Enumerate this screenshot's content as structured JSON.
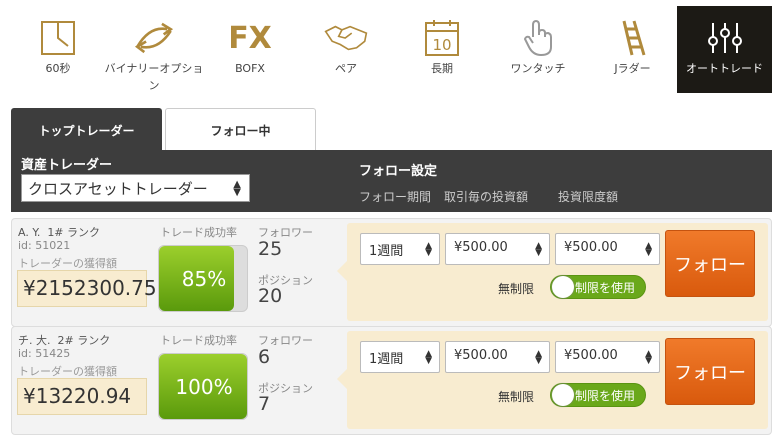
{
  "nav": [
    {
      "icon": "timer-60-icon",
      "label": "60秒"
    },
    {
      "icon": "binary-arrows-icon",
      "label": "バイナリーオプション"
    },
    {
      "icon": "fx-icon",
      "label": "BOFX"
    },
    {
      "icon": "handshake-icon",
      "label": "ペア"
    },
    {
      "icon": "calendar-10-icon",
      "label": "長期"
    },
    {
      "icon": "touch-hand-icon",
      "label": "ワンタッチ"
    },
    {
      "icon": "ladder-icon",
      "label": "Jラダー"
    },
    {
      "icon": "sliders-icon",
      "label": "オートトレード"
    }
  ],
  "tabs": {
    "top": "トップトレーダー",
    "following": "フォロー中"
  },
  "header": {
    "asset_label": "資産トレーダー",
    "asset_select": "クロスアセットトレーダー",
    "follow_settings": "フォロー設定",
    "col_period": "フォロー期間",
    "col_per_trade": "取引毎の投資額",
    "col_limit": "投資限度額"
  },
  "labels": {
    "earnings": "トレーダーの獲得額",
    "success_rate": "トレード成功率",
    "followers": "フォロワー",
    "positions": "ポジション",
    "unlimited": "無制限",
    "use_limit": "制限を使用",
    "follow_btn": "フォロー"
  },
  "traders": [
    {
      "name": "A. Y.",
      "rank": "1# ランク",
      "id": "id: 51021",
      "earnings": "¥2152300.75",
      "rate_text": "85%",
      "rate": 0.85,
      "followers": "25",
      "positions": "20",
      "period": "1週間",
      "per_trade": "¥500.00",
      "limit": "¥500.00"
    },
    {
      "name": "チ. 大.",
      "rank": "2# ランク",
      "id": "id: 51425",
      "earnings": "¥13220.94",
      "rate_text": "100%",
      "rate": 1.0,
      "followers": "6",
      "positions": "7",
      "period": "1週間",
      "per_trade": "¥500.00",
      "limit": "¥500.00"
    }
  ],
  "colors": {
    "accent": "#b08a3c",
    "follow": "#e4661a",
    "success": "#7ab51d",
    "dark": "#3d3d3d"
  }
}
